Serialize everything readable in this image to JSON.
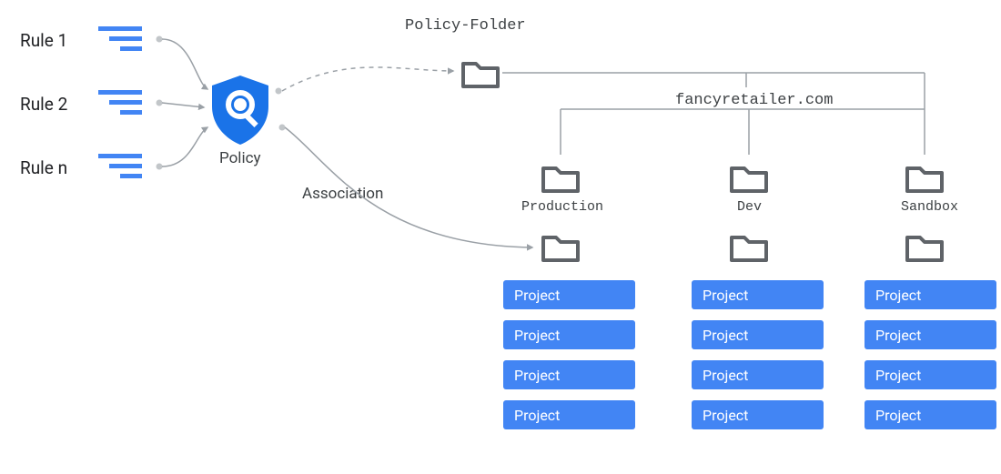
{
  "rules": {
    "r1": "Rule 1",
    "r2": "Rule 2",
    "rn": "Rule n"
  },
  "policy": {
    "label": "Policy",
    "folder_label": "Policy-Folder",
    "association_label": "Association"
  },
  "org": {
    "domain": "fancyretailer.com",
    "production_label": "Production",
    "dev_label": "Dev",
    "sandbox_label": "Sandbox"
  },
  "projects": {
    "prod": [
      "Project",
      "Project",
      "Project",
      "Project"
    ],
    "dev": [
      "Project",
      "Project",
      "Project",
      "Project"
    ],
    "sand": [
      "Project",
      "Project",
      "Project",
      "Project"
    ]
  },
  "colors": {
    "blue": "#4285f4",
    "darkblue": "#1a73e8",
    "grey": "#9aa0a6",
    "darkgrey": "#5f6368"
  }
}
